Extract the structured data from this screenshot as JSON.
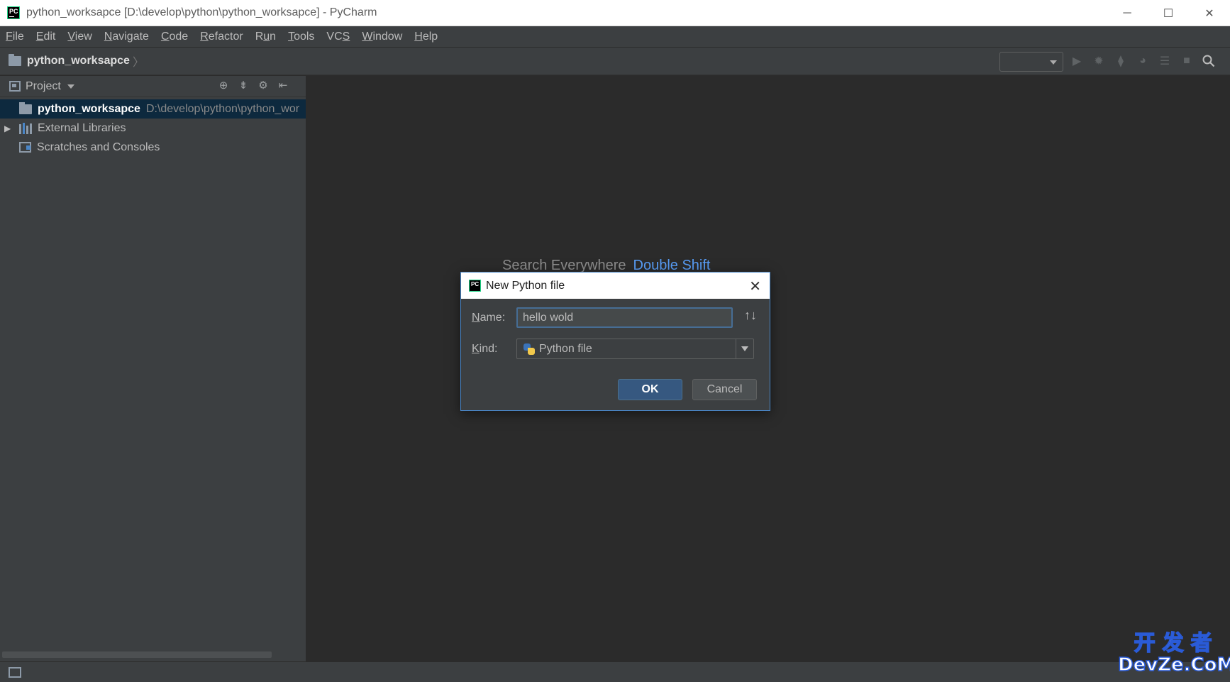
{
  "window": {
    "title": "python_worksapce [D:\\develop\\python\\python_worksapce] - PyCharm",
    "app_icon": "pycharm-icon",
    "controls": {
      "minimize": "─",
      "maximize": "☐",
      "close": "✕"
    }
  },
  "menubar": {
    "items": [
      {
        "pre": "",
        "u": "F",
        "post": "ile"
      },
      {
        "pre": "",
        "u": "E",
        "post": "dit"
      },
      {
        "pre": "",
        "u": "V",
        "post": "iew"
      },
      {
        "pre": "",
        "u": "N",
        "post": "avigate"
      },
      {
        "pre": "",
        "u": "C",
        "post": "ode"
      },
      {
        "pre": "",
        "u": "R",
        "post": "efactor"
      },
      {
        "pre": "R",
        "u": "u",
        "post": "n"
      },
      {
        "pre": "",
        "u": "T",
        "post": "ools"
      },
      {
        "pre": "VC",
        "u": "S",
        "post": ""
      },
      {
        "pre": "",
        "u": "W",
        "post": "indow"
      },
      {
        "pre": "",
        "u": "H",
        "post": "elp"
      }
    ]
  },
  "navbar": {
    "project": "python_worksapce",
    "separator": "〉",
    "toolbar_icons": [
      "run-icon",
      "debug-icon",
      "coverage-icon",
      "profile-icon",
      "build-icon",
      "stop-icon",
      "search-icon"
    ]
  },
  "project_panel": {
    "header_label": "Project",
    "tree": [
      {
        "label": "python_worksapce",
        "path": "D:\\develop\\python\\python_wor",
        "icon": "folder-icon",
        "selected": true
      },
      {
        "label": "External Libraries",
        "path": "",
        "icon": "library-icon",
        "expandable": true
      },
      {
        "label": "Scratches and Consoles",
        "path": "",
        "icon": "scratch-icon"
      }
    ]
  },
  "editor": {
    "hint_text": "Search Everywhere",
    "hint_shortcut": "Double Shift"
  },
  "dialog": {
    "title": "New Python file",
    "name_label_u": "N",
    "name_label_rest": "ame:",
    "name_value": "hello wold",
    "kind_label_u": "K",
    "kind_label_rest": "ind:",
    "kind_value": "Python file",
    "ok_label": "OK",
    "cancel_label": "Cancel",
    "sort_symbol": "↑↓"
  },
  "watermark": {
    "line1": "开发者",
    "line2": "DevZe.CoM"
  },
  "colors": {
    "accent": "#4a86c7",
    "background": "#2b2b2b",
    "panel": "#3c3f41",
    "link": "#589df6"
  }
}
